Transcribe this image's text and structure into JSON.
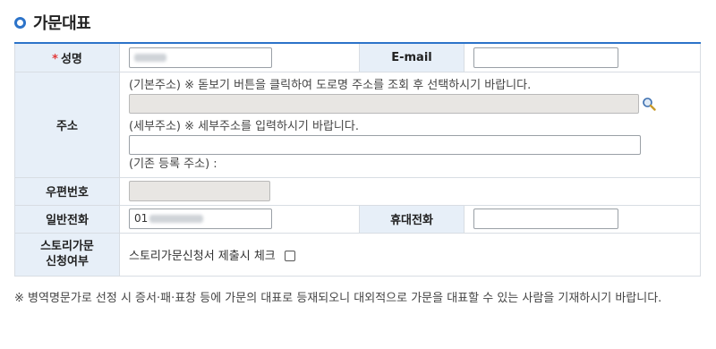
{
  "section": {
    "title": "가문대표"
  },
  "form": {
    "name_label": "성명",
    "required_mark": "*",
    "email_label": "E-mail",
    "email_value": "",
    "address_label": "주소",
    "address_basic_note": "(기본주소) ※ 돋보기 버튼을 클릭하여 도로명 주소를 조회 후 선택하시기 바랍니다.",
    "address_basic_value": "",
    "address_detail_note": "(세부주소) ※ 세부주소를 입력하시기 바랍니다.",
    "address_detail_value": "",
    "address_old_note": "(기존 등록 주소) :",
    "postal_label": "우편번호",
    "postal_value": "",
    "phone_label": "일반전화",
    "phone_prefix": "01",
    "mobile_label": "휴대전화",
    "mobile_value": "",
    "story_label_line1": "스토리가문",
    "story_label_line2": "신청여부",
    "story_check_text": "스토리가문신청서 제출시 체크"
  },
  "footnote": "※ 병역명문가로 선정 시 증서·패·표창 등에 가문의 대표로 등재되오니 대외적으로 가문을 대표할 수 있는 사람을 기재하시기 바랍니다.",
  "icons": {
    "title_bullet": "ring-bullet-icon",
    "search": "magnifier-icon"
  },
  "colors": {
    "accent": "#2c73c9",
    "header_bg": "#e7eff8",
    "required": "#e23a3a",
    "readonly_bg": "#e8e6e3"
  }
}
